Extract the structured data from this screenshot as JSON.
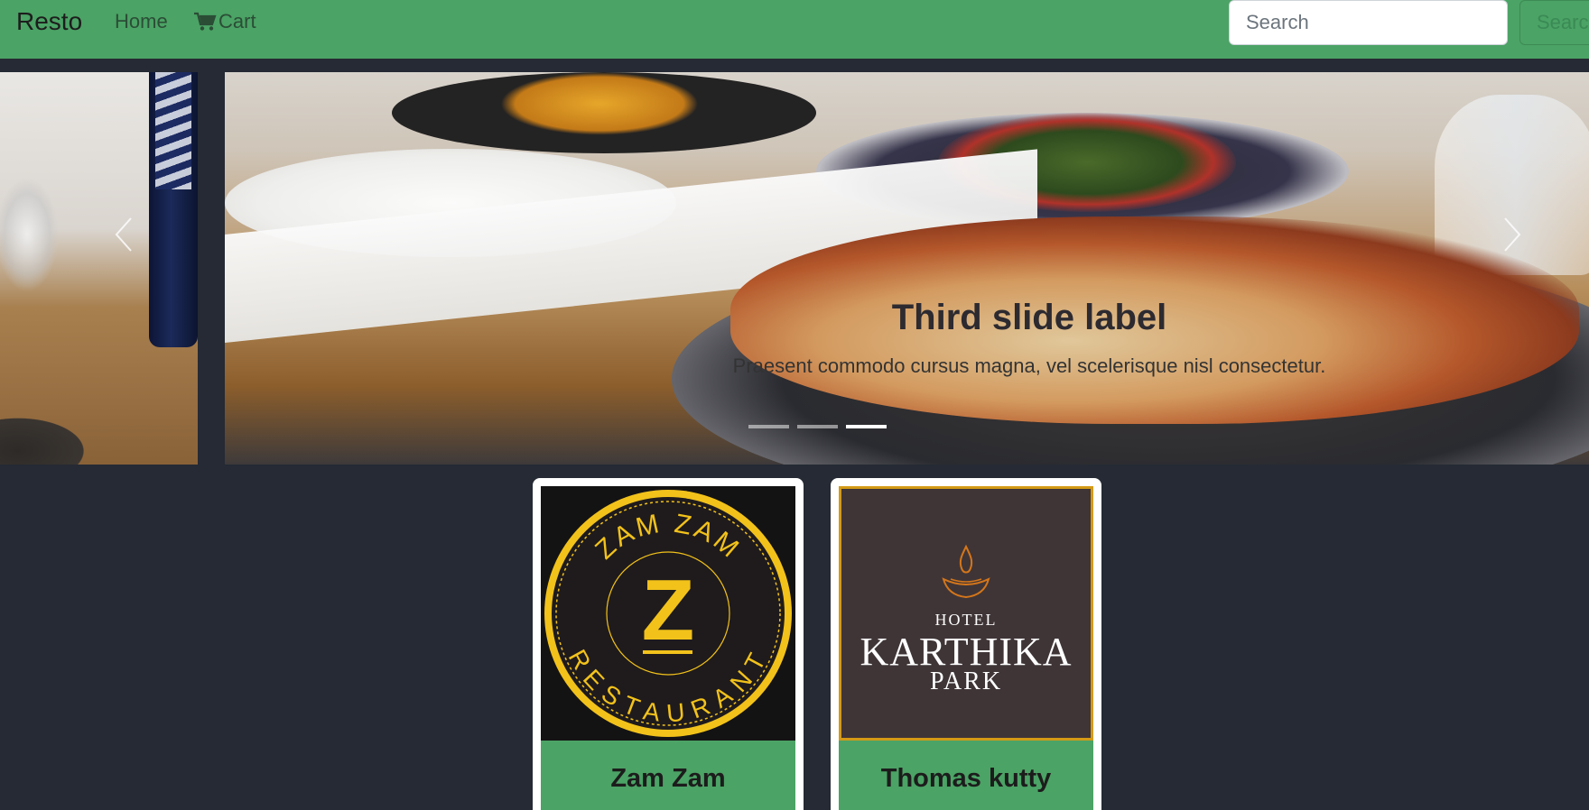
{
  "navbar": {
    "brand": "Resto",
    "links": [
      {
        "label": "Home",
        "icon": null
      },
      {
        "label": "Cart",
        "icon": "cart-icon"
      }
    ],
    "search": {
      "placeholder": "Search",
      "value": ""
    },
    "search_button_label": "Search"
  },
  "carousel": {
    "active_index": 2,
    "slide_count": 3,
    "caption": {
      "title": "Third slide label",
      "text": "Praesent commodo cursus magna, vel scelerisque nisl consectetur."
    },
    "prev_icon": "chevron-left-icon",
    "next_icon": "chevron-right-icon"
  },
  "restaurants": [
    {
      "name": "Zam Zam",
      "logo": {
        "top_text": "ZAM ZAM",
        "bottom_text": "RESTAURANT",
        "monogram": "Z",
        "color": "#f2c21b"
      }
    },
    {
      "name": "Thomas kutty",
      "logo": {
        "line1": "HOTEL",
        "line2": "KARTHIKA",
        "line3": "PARK",
        "accent": "#d49a16"
      }
    }
  ],
  "colors": {
    "navbar": "#4ba365",
    "background": "#252a34",
    "card_title_bg": "#4ba365"
  }
}
